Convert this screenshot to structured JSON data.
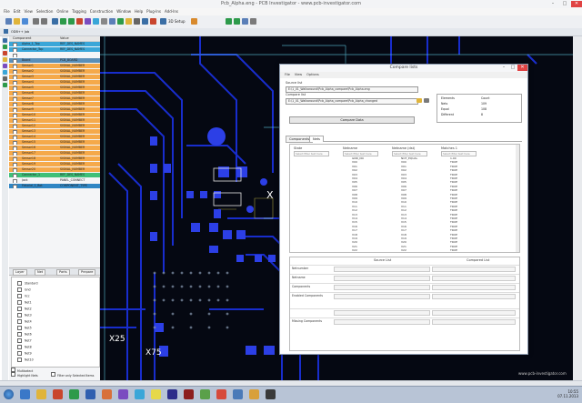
{
  "window": {
    "title": "Pcb_Alpha.eng - PCB Investigator - www.pcb-investigator.com",
    "controls": {
      "min": "–",
      "max": "□",
      "close": "✕"
    }
  },
  "menubar": [
    "File",
    "Edit",
    "View",
    "Selection",
    "Online",
    "Tagging",
    "Construction",
    "Window",
    "Help",
    "Plug-Ins",
    "Add-Ins"
  ],
  "toolbar": {
    "setup_label": "3D Setup"
  },
  "subbar": {
    "label": "ODB++ Job"
  },
  "left_panel": {
    "headers": {
      "col1": "Component",
      "col2": "Value"
    },
    "rows": [
      {
        "name": "Alpha_1_Top",
        "value": "REF_DES_NAMES",
        "color": "#3aa6d8"
      },
      {
        "name": "Connector_Top",
        "value": "REF_DES_NAMES",
        "color": "#3aa6d8"
      },
      {
        "name": "",
        "value": "",
        "color": "#f4f5f7"
      },
      {
        "name": "Board",
        "value": "PCB_BOARD",
        "color": "#5a8fb8"
      },
      {
        "name": "Sensor1",
        "value": "SIGNAL_NUMBER",
        "color": "#f5a94a"
      },
      {
        "name": "Sensor2",
        "value": "SIGNAL_NUMBER",
        "color": "#f5a94a"
      },
      {
        "name": "Sensor3",
        "value": "SIGNAL_NUMBER",
        "color": "#f5a94a"
      },
      {
        "name": "Sensor4",
        "value": "SIGNAL_NUMBER",
        "color": "#f5a94a"
      },
      {
        "name": "Sensor5",
        "value": "SIGNAL_NUMBER",
        "color": "#f5a94a"
      },
      {
        "name": "Sensor6",
        "value": "SIGNAL_NUMBER",
        "color": "#f5a94a"
      },
      {
        "name": "Sensor7",
        "value": "SIGNAL_NUMBER",
        "color": "#f5a94a"
      },
      {
        "name": "Sensor8",
        "value": "SIGNAL_NUMBER",
        "color": "#f5a94a"
      },
      {
        "name": "Sensor9",
        "value": "SIGNAL_NUMBER",
        "color": "#f5a94a"
      },
      {
        "name": "Sensor10",
        "value": "SIGNAL_NUMBER",
        "color": "#f5a94a"
      },
      {
        "name": "Sensor11",
        "value": "SIGNAL_NUMBER",
        "color": "#f5a94a"
      },
      {
        "name": "Sensor12",
        "value": "SIGNAL_NUMBER",
        "color": "#f5a94a"
      },
      {
        "name": "Sensor13",
        "value": "SIGNAL_NUMBER",
        "color": "#f5a94a"
      },
      {
        "name": "Sensor14",
        "value": "SIGNAL_NUMBER",
        "color": "#f5a94a"
      },
      {
        "name": "Sensor15",
        "value": "SIGNAL_NUMBER",
        "color": "#f5a94a"
      },
      {
        "name": "Sensor16",
        "value": "SIGNAL_NUMBER",
        "color": "#f5a94a"
      },
      {
        "name": "Sensor17",
        "value": "SIGNAL_NUMBER",
        "color": "#f5a94a"
      },
      {
        "name": "Sensor18",
        "value": "SIGNAL_NUMBER",
        "color": "#f5a94a"
      },
      {
        "name": "Sensor19",
        "value": "SIGNAL_NUMBER",
        "color": "#f5a94a"
      },
      {
        "name": "Sensor20",
        "value": "SIGNAL_NUMBER",
        "color": "#f5a94a"
      },
      {
        "name": "Connector_1",
        "value": "REF_DES_NAMES",
        "color": "#3fbf78"
      },
      {
        "name": "Jack",
        "value": "PANEL_CONNECT",
        "color": "#f4f5f7"
      },
      {
        "name": "Fiducial_1_Bot",
        "value": "COMPONENT_TYPE",
        "color": "#2f86c4"
      }
    ],
    "tabs": [
      "Layer",
      "Net",
      "Parts",
      "Prepare"
    ],
    "tree": [
      "Standard",
      "Gnd",
      "Vcc",
      "Net1",
      "Net2",
      "Net3",
      "Net4",
      "Net5",
      "Net6",
      "Net7",
      "Net8",
      "Net9",
      "Net10"
    ],
    "footer": {
      "option1": "Multiselect",
      "option2": "Highlight Nets",
      "option3": "Filter only Selected Items"
    }
  },
  "dialog": {
    "title": "Compare lists",
    "menu": [
      "File",
      "View",
      "Options"
    ],
    "source_label": "Source list",
    "source_value": "E:\\1_01_Walkaround\\Pcb_Alpha_compare\\Pcb_Alpha.eng",
    "compare_label": "Compare list",
    "compare_value": "E:\\1_01_Walkaround\\Pcb_Alpha_compare\\Pcb_Alpha_changed",
    "compare_button": "Compare Data",
    "summary": {
      "headers": [
        "Elements",
        "Count"
      ],
      "rows": [
        {
          "k": "Nets",
          "v": "109"
        },
        {
          "k": "Equal",
          "v": "108"
        },
        {
          "k": "Different",
          "v": "8"
        }
      ]
    },
    "tabs": [
      "Components",
      "Nets"
    ],
    "grid": {
      "headers": [
        "State",
        "Netname",
        "Netname (dst)",
        "Matches 1"
      ],
      "filter_placeholder": "Select filter text here",
      "rows": [
        [
          "",
          "GND_NO",
          "NOT_EQUAL",
          "1.00"
        ],
        [
          "",
          "V00",
          "V00",
          "TRUE"
        ],
        [
          "",
          "V01",
          "V01",
          "TRUE"
        ],
        [
          "",
          "V02",
          "V02",
          "TRUE"
        ],
        [
          "",
          "V03",
          "V03",
          "TRUE"
        ],
        [
          "",
          "V04",
          "V04",
          "TRUE"
        ],
        [
          "",
          "V05",
          "V05",
          "TRUE"
        ],
        [
          "",
          "V06",
          "V06",
          "TRUE"
        ],
        [
          "",
          "V07",
          "V07",
          "TRUE"
        ],
        [
          "",
          "V08",
          "V08",
          "TRUE"
        ],
        [
          "",
          "V09",
          "V09",
          "TRUE"
        ],
        [
          "",
          "V10",
          "V10",
          "TRUE"
        ],
        [
          "",
          "V11",
          "V11",
          "TRUE"
        ],
        [
          "",
          "V12",
          "V12",
          "TRUE"
        ],
        [
          "",
          "V13",
          "V13",
          "TRUE"
        ],
        [
          "",
          "V14",
          "V14",
          "TRUE"
        ],
        [
          "",
          "V15",
          "V15",
          "TRUE"
        ],
        [
          "",
          "V16",
          "V16",
          "TRUE"
        ],
        [
          "",
          "V17",
          "V17",
          "TRUE"
        ],
        [
          "",
          "V18",
          "V18",
          "TRUE"
        ],
        [
          "",
          "V19",
          "V19",
          "TRUE"
        ],
        [
          "",
          "V20",
          "V20",
          "TRUE"
        ],
        [
          "",
          "V21",
          "V21",
          "TRUE"
        ],
        [
          "",
          "V22",
          "V22",
          "TRUE"
        ]
      ]
    },
    "lower": {
      "headers": [
        "Source List",
        "Compared List"
      ],
      "rows": [
        "Netnumber",
        "Netname",
        "Components",
        "Enabled Components",
        "",
        "Missing Components"
      ]
    }
  },
  "canvas": {
    "label1": "X",
    "label2": "X25",
    "label3": "X75",
    "watermark": "www.pcb-investigator.com"
  },
  "taskbar": {
    "time": "10:55",
    "date": "07.11.2013"
  }
}
